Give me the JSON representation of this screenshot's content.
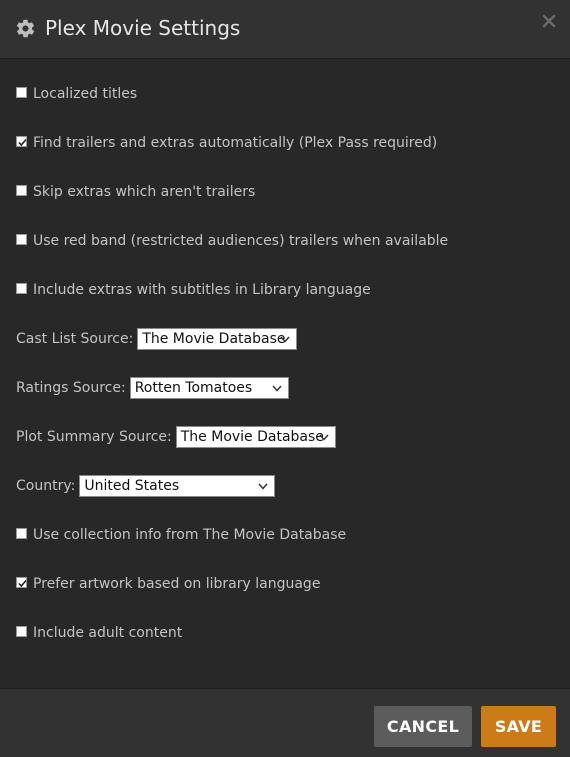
{
  "header": {
    "title": "Plex Movie Settings",
    "icon": "gear-icon",
    "close_icon": "close-icon"
  },
  "options": [
    {
      "label": "Localized titles",
      "checked": false
    },
    {
      "label": "Find trailers and extras automatically (Plex Pass required)",
      "checked": true
    },
    {
      "label": "Skip extras which aren't trailers",
      "checked": false
    },
    {
      "label": "Use red band (restricted audiences) trailers when available",
      "checked": false
    },
    {
      "label": "Include extras with subtitles in Library language",
      "checked": false
    }
  ],
  "selects": [
    {
      "label": "Cast List Source:",
      "value": "The Movie Database"
    },
    {
      "label": "Ratings Source:",
      "value": "Rotten Tomatoes"
    },
    {
      "label": "Plot Summary Source:",
      "value": "The Movie Database"
    },
    {
      "label": "Country:",
      "value": "United States"
    }
  ],
  "options2": [
    {
      "label": "Use collection info from The Movie Database",
      "checked": false
    },
    {
      "label": "Prefer artwork based on library language",
      "checked": true
    },
    {
      "label": "Include adult content",
      "checked": false
    }
  ],
  "footer": {
    "cancel_label": "CANCEL",
    "save_label": "SAVE"
  },
  "colors": {
    "background": "#282828",
    "header": "#323232",
    "save": "#cc7b19",
    "cancel": "#5c5c5c"
  }
}
